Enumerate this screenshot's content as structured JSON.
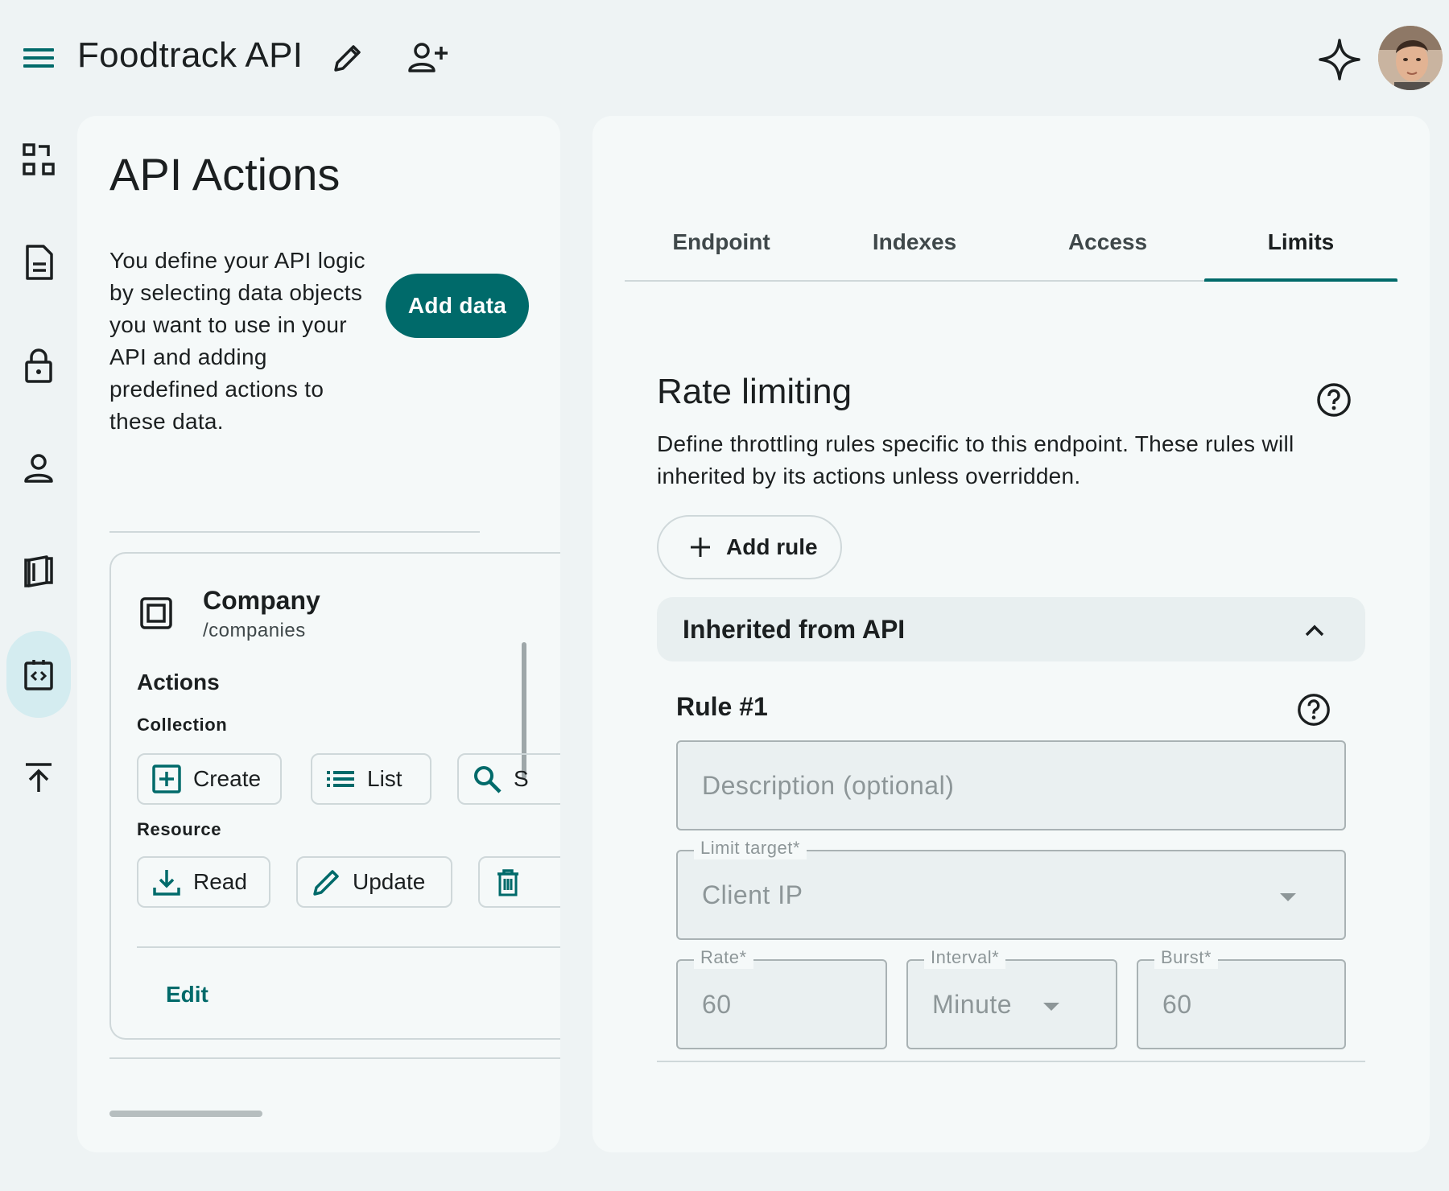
{
  "header": {
    "title": "Foodtrack API",
    "icons": [
      "menu-icon",
      "edit-icon",
      "person-add-icon",
      "sparkle-icon",
      "avatar"
    ]
  },
  "nav": {
    "items": [
      {
        "icon": "dashboard-icon"
      },
      {
        "icon": "document-icon"
      },
      {
        "icon": "lock-icon"
      },
      {
        "icon": "person-icon"
      },
      {
        "icon": "book-icon"
      },
      {
        "icon": "api-code-icon",
        "active": true
      },
      {
        "icon": "upload-icon"
      }
    ]
  },
  "actions_panel": {
    "title": "API Actions",
    "description": "You define your API logic by selecting data objects you want to use in your API and adding predefined actions to these data.",
    "add_data_label": "Add data",
    "card": {
      "name": "Company",
      "path": "/companies",
      "actions_label": "Actions",
      "collection_label": "Collection",
      "collection_actions": [
        "Create",
        "List",
        "S"
      ],
      "resource_label": "Resource",
      "resource_actions": [
        "Read",
        "Update",
        ""
      ],
      "edit_label": "Edit"
    }
  },
  "settings_panel": {
    "tabs": [
      "Endpoint",
      "Indexes",
      "Access",
      "Limits"
    ],
    "active_tab": "Limits",
    "rate_limiting": {
      "title": "Rate limiting",
      "description": "Define throttling rules specific to this endpoint. These rules will inherited by its actions unless overridden.",
      "add_rule_label": "Add rule",
      "inherited_label": "Inherited from API",
      "rule": {
        "title": "Rule #1",
        "description_placeholder": "Description (optional)",
        "limit_target_label": "Limit target*",
        "limit_target_value": "Client IP",
        "rate_label": "Rate*",
        "rate_value": "60",
        "interval_label": "Interval*",
        "interval_value": "Minute",
        "burst_label": "Burst*",
        "burst_value": "60"
      }
    }
  },
  "colors": {
    "primary": "#006a6a",
    "background": "#eef3f4",
    "surface": "#f5f9f9",
    "active_nav": "#d4ecf0"
  }
}
